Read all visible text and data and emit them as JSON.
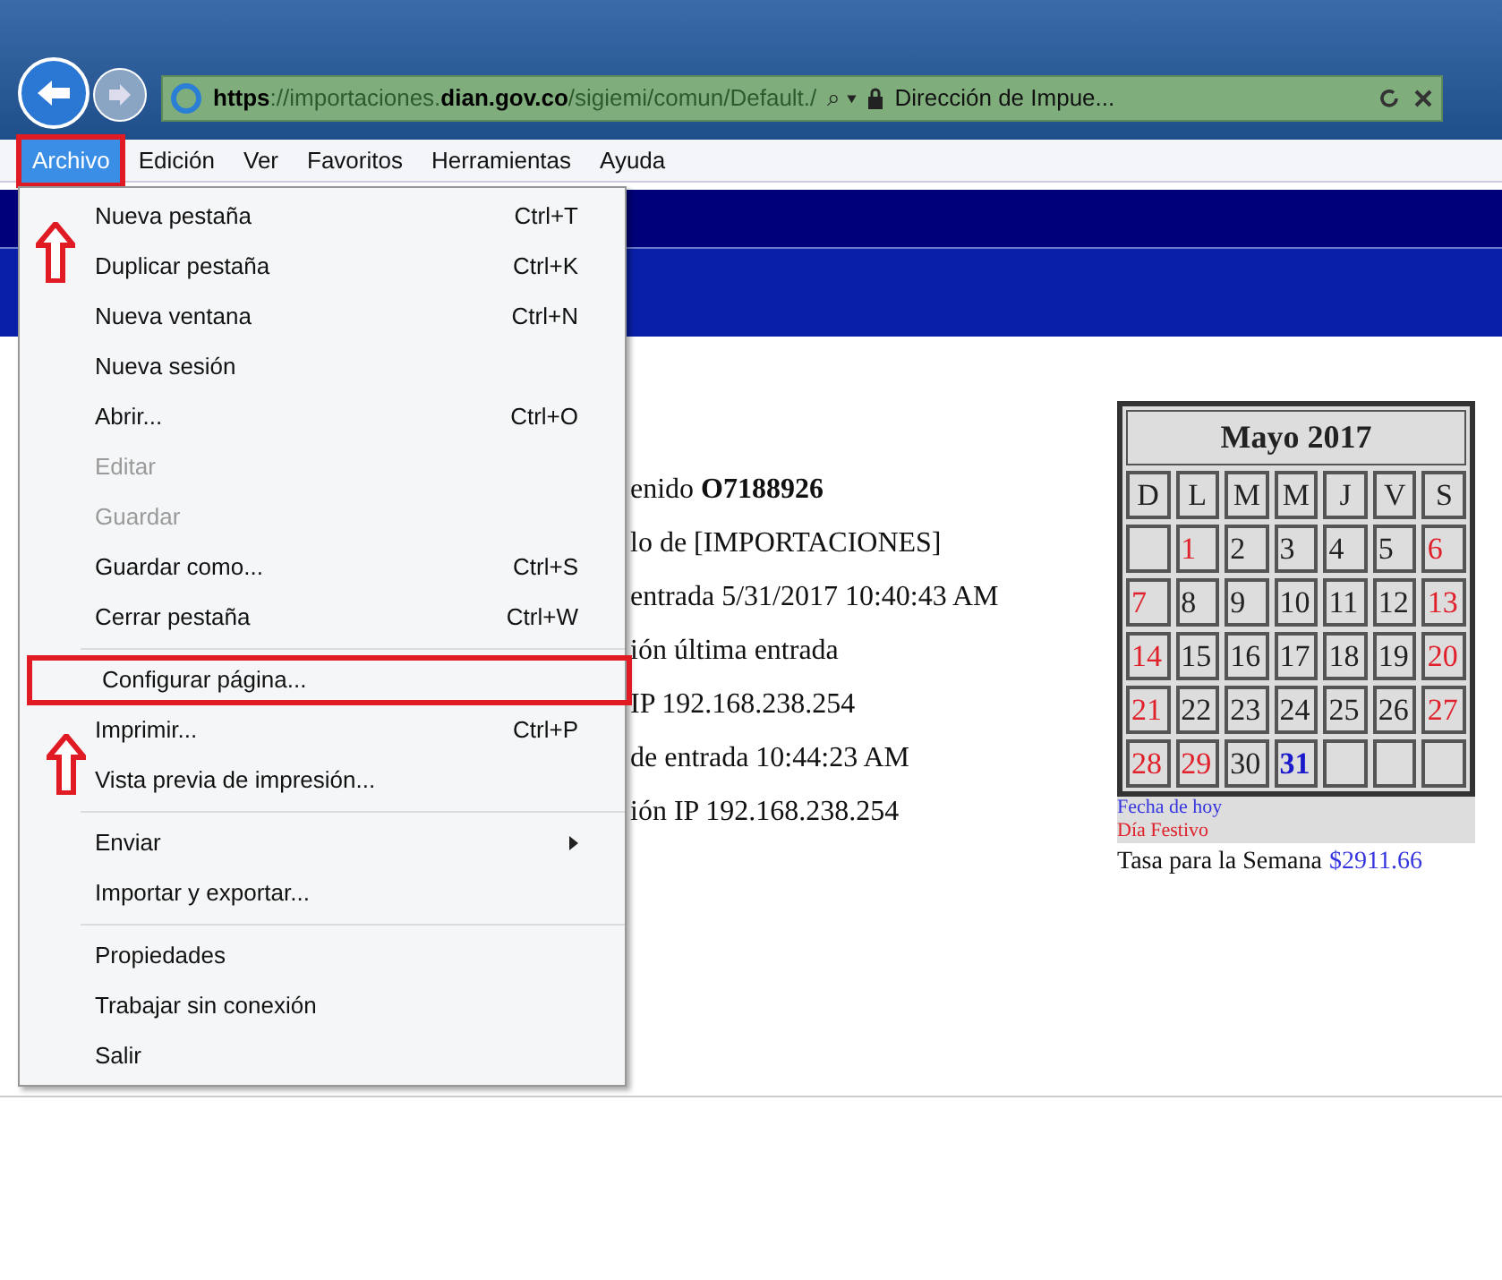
{
  "address_bar": {
    "url": [
      {
        "text": "https",
        "dim": false
      },
      {
        "text": "://importaciones.",
        "dim": true
      },
      {
        "text": "dian.gov.co",
        "dim": false
      },
      {
        "text": "/sigiemi/comun/Default./",
        "dim": true
      }
    ],
    "search_icon": "⌕ ▾",
    "tab_title": "Dirección de Impue..."
  },
  "menu_bar": [
    {
      "label": "Archivo",
      "selected": true,
      "highlighted": true
    },
    {
      "label": "Edición",
      "selected": false,
      "highlighted": false
    },
    {
      "label": "Ver",
      "selected": false,
      "highlighted": false
    },
    {
      "label": "Favoritos",
      "selected": false,
      "highlighted": false
    },
    {
      "label": "Herramientas",
      "selected": false,
      "highlighted": false
    },
    {
      "label": "Ayuda",
      "selected": false,
      "highlighted": false
    }
  ],
  "menu_groups": [
    [
      {
        "label": "Nueva pestaña",
        "shortcut": "Ctrl+T",
        "disabled": false,
        "submenu": false,
        "highlighted": false
      },
      {
        "label": "Duplicar pestaña",
        "shortcut": "Ctrl+K",
        "disabled": false,
        "submenu": false,
        "highlighted": false
      },
      {
        "label": "Nueva ventana",
        "shortcut": "Ctrl+N",
        "disabled": false,
        "submenu": false,
        "highlighted": false
      },
      {
        "label": "Nueva sesión",
        "disabled": false,
        "submenu": false,
        "highlighted": false
      },
      {
        "label": "Abrir...",
        "shortcut": "Ctrl+O",
        "disabled": false,
        "submenu": false,
        "highlighted": false
      },
      {
        "label": "Editar",
        "disabled": true,
        "submenu": false,
        "highlighted": false
      },
      {
        "label": "Guardar",
        "disabled": true,
        "submenu": false,
        "highlighted": false
      },
      {
        "label": "Guardar como...",
        "shortcut": "Ctrl+S",
        "disabled": false,
        "submenu": false,
        "highlighted": false
      },
      {
        "label": "Cerrar pestaña",
        "shortcut": "Ctrl+W",
        "disabled": false,
        "submenu": false,
        "highlighted": false
      }
    ],
    [
      {
        "label": "Configurar página...",
        "disabled": false,
        "submenu": false,
        "highlighted": true
      },
      {
        "label": "Imprimir...",
        "shortcut": "Ctrl+P",
        "disabled": false,
        "submenu": false,
        "highlighted": false
      },
      {
        "label": "Vista previa de impresión...",
        "disabled": false,
        "submenu": false,
        "highlighted": false
      }
    ],
    [
      {
        "label": "Enviar",
        "disabled": false,
        "submenu": true,
        "highlighted": false
      },
      {
        "label": "Importar y exportar...",
        "disabled": false,
        "submenu": false,
        "highlighted": false
      }
    ],
    [
      {
        "label": "Propiedades",
        "disabled": false,
        "submenu": false,
        "highlighted": false
      },
      {
        "label": "Trabajar sin conexión",
        "disabled": false,
        "submenu": false,
        "highlighted": false
      },
      {
        "label": "Salir",
        "disabled": false,
        "submenu": false,
        "highlighted": false
      }
    ]
  ],
  "info_lines": [
    "enido **O7188926**",
    "lo de [IMPORTACIONES]",
    "entrada 5/31/2017 10:40:43 AM",
    "ión última entrada",
    "IP 192.168.238.254",
    "de entrada 10:44:23 AM",
    "ión IP 192.168.238.254"
  ],
  "calendar": {
    "title": "Mayo 2017",
    "weekdays": [
      "D",
      "L",
      "M",
      "M",
      "J",
      "V",
      "S"
    ],
    "days": [
      {
        "kind": "empty"
      },
      {
        "text": "1",
        "kind": "holiday"
      },
      {
        "text": "2",
        "kind": "normal"
      },
      {
        "text": "3",
        "kind": "normal"
      },
      {
        "text": "4",
        "kind": "normal"
      },
      {
        "text": "5",
        "kind": "normal"
      },
      {
        "text": "6",
        "kind": "holiday"
      },
      {
        "text": "7",
        "kind": "holiday"
      },
      {
        "text": "8",
        "kind": "normal"
      },
      {
        "text": "9",
        "kind": "normal"
      },
      {
        "text": "10",
        "kind": "normal"
      },
      {
        "text": "11",
        "kind": "normal"
      },
      {
        "text": "12",
        "kind": "normal"
      },
      {
        "text": "13",
        "kind": "holiday"
      },
      {
        "text": "14",
        "kind": "holiday"
      },
      {
        "text": "15",
        "kind": "normal"
      },
      {
        "text": "16",
        "kind": "normal"
      },
      {
        "text": "17",
        "kind": "normal"
      },
      {
        "text": "18",
        "kind": "normal"
      },
      {
        "text": "19",
        "kind": "normal"
      },
      {
        "text": "20",
        "kind": "holiday"
      },
      {
        "text": "21",
        "kind": "holiday"
      },
      {
        "text": "22",
        "kind": "normal"
      },
      {
        "text": "23",
        "kind": "normal"
      },
      {
        "text": "24",
        "kind": "normal"
      },
      {
        "text": "25",
        "kind": "normal"
      },
      {
        "text": "26",
        "kind": "normal"
      },
      {
        "text": "27",
        "kind": "holiday"
      },
      {
        "text": "28",
        "kind": "holiday"
      },
      {
        "text": "29",
        "kind": "holiday"
      },
      {
        "text": "30",
        "kind": "normal"
      },
      {
        "text": "31",
        "kind": "today"
      },
      {
        "kind": "empty"
      },
      {
        "kind": "empty"
      },
      {
        "kind": "empty"
      }
    ],
    "legend": [
      {
        "text": "Fecha de hoy",
        "kind": "today"
      },
      {
        "text": "Día Festivo",
        "kind": "holiday"
      }
    ],
    "rate_label": "Tasa para la Semana",
    "rate_value": "$2911.66"
  }
}
